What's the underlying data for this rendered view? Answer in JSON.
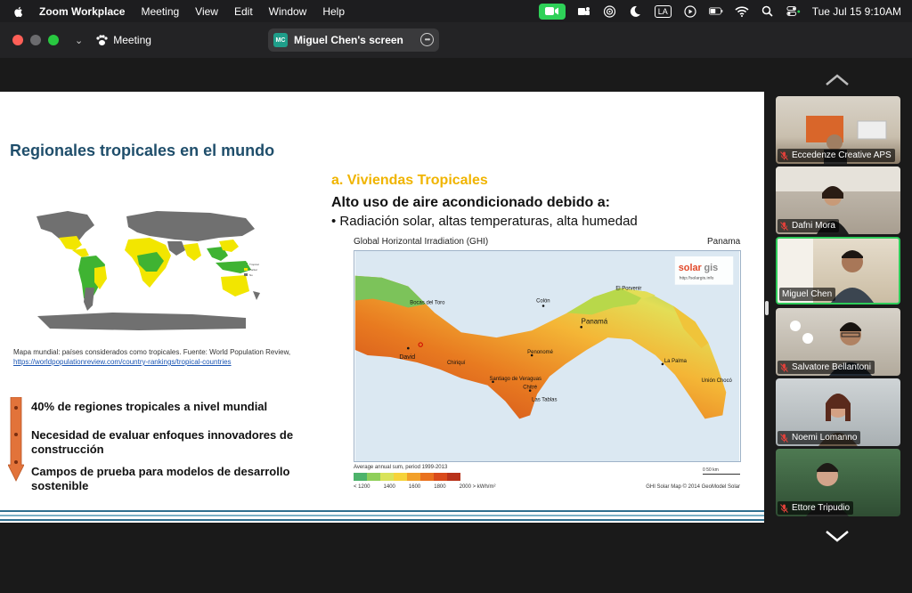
{
  "menubar": {
    "app": "Zoom Workplace",
    "items": [
      "Meeting",
      "View",
      "Edit",
      "Window",
      "Help"
    ],
    "input_source": "LA",
    "clock": "Tue Jul 15  9:10AM"
  },
  "window": {
    "meeting_label": "Meeting",
    "share_initials": "MC",
    "share_title": "Miguel Chen's screen"
  },
  "slide": {
    "title": "Regionales tropicales en el mundo",
    "map_caption_text": "Mapa mundial: países considerados como tropicales. Fuente: World Population Review, ",
    "map_caption_link": "https://worldpopulationreview.com/country-rankings/tropical-countries",
    "bullets": [
      "40% de regiones tropicales a nivel mundial",
      "Necesidad de evaluar enfoques innovadores de construcción",
      "Campos de prueba para modelos de desarrollo sostenible"
    ],
    "subheading": "a. Viviendas Tropicales",
    "main_line": "Alto uso de aire acondicionado debido a:",
    "bullet_line": "•   Radiación solar, altas temperaturas, alta humedad",
    "ghi_title": "Global Horizontal Irradiation (GHI)",
    "ghi_country": "Panama",
    "solargis_logo": "solargis",
    "solargis_url": "http://solargis.info",
    "towns": [
      "Bocas del Toro",
      "Colón",
      "El Porvenir",
      "Panamá",
      "David",
      "Chiriquí",
      "Penonomé",
      "La Palma",
      "Unión Chocó",
      "Santiago de Veraguas",
      "Chitré",
      "Las Tablas"
    ],
    "legend_title": "Average annual sum, period 1999-2013",
    "legend_ticks": [
      "< 1200",
      "1400",
      "1600",
      "1800",
      "2000 > kWh/m²"
    ],
    "legend_colors": [
      "#4db36b",
      "#8fcf5a",
      "#d9e35a",
      "#f6d33a",
      "#f2a02a",
      "#e9711e",
      "#d94a1a",
      "#b8321a"
    ],
    "legend_credit": "GHI Solar Map © 2014 GeoModel Solar",
    "scale_label": "0         50 km"
  },
  "participants": [
    {
      "name": "Eccedenze Creative APS",
      "muted": true
    },
    {
      "name": "Dafni Mora",
      "muted": true
    },
    {
      "name": "Miguel Chen",
      "muted": false,
      "active": true
    },
    {
      "name": "Salvatore Bellantoni",
      "muted": true
    },
    {
      "name": "Noemi Lomanno",
      "muted": true
    },
    {
      "name": "Ettore Tripudio",
      "muted": true
    }
  ]
}
